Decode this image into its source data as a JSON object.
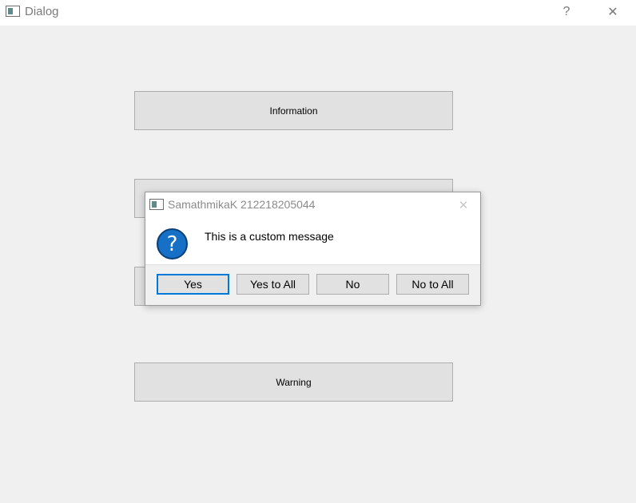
{
  "window": {
    "title": "Dialog",
    "help_glyph": "?",
    "close_glyph": "✕"
  },
  "buttons": {
    "information": "Information",
    "hidden_1": "",
    "hidden_2": "",
    "warning": "Warning"
  },
  "messagebox": {
    "title": "SamathmikaK 212218205044",
    "close_glyph": "✕",
    "icon_glyph": "?",
    "icon_name": "question-icon",
    "message": "This is a custom message",
    "buttons": [
      "Yes",
      "Yes to All",
      "No",
      "No to All"
    ],
    "default_button": "Yes",
    "accent_color": "#0078d7",
    "icon_color": "#1670c6"
  }
}
